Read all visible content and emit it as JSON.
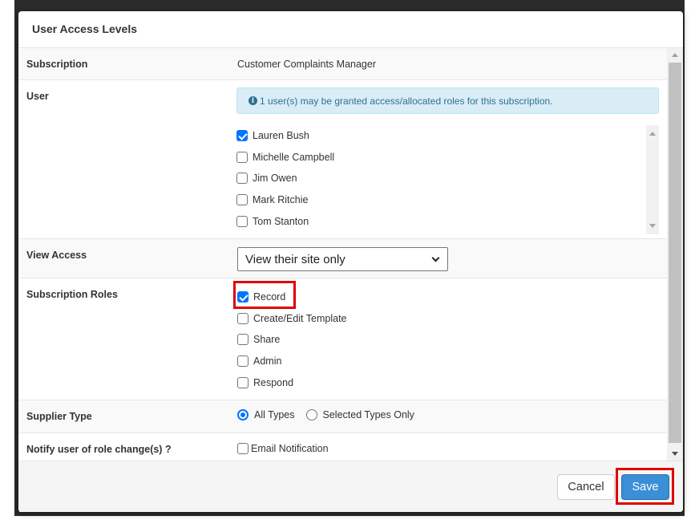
{
  "modal": {
    "title": "User Access Levels"
  },
  "subscription": {
    "label": "Subscription",
    "value": "Customer Complaints Manager"
  },
  "user": {
    "label": "User",
    "info_message": "1 user(s) may be granted access/allocated roles for this subscription.",
    "users": [
      {
        "name": "Lauren Bush",
        "checked": true
      },
      {
        "name": "Michelle Campbell",
        "checked": false
      },
      {
        "name": "Jim Owen",
        "checked": false
      },
      {
        "name": "Mark Ritchie",
        "checked": false
      },
      {
        "name": "Tom Stanton",
        "checked": false
      }
    ]
  },
  "view_access": {
    "label": "View Access",
    "selected": "View their site only"
  },
  "subscription_roles": {
    "label": "Subscription Roles",
    "roles": [
      {
        "name": "Record",
        "checked": true
      },
      {
        "name": "Create/Edit Template",
        "checked": false
      },
      {
        "name": "Share",
        "checked": false
      },
      {
        "name": "Admin",
        "checked": false
      },
      {
        "name": "Respond",
        "checked": false
      }
    ]
  },
  "supplier_type": {
    "label": "Supplier Type",
    "options": [
      {
        "name": "All Types",
        "checked": true
      },
      {
        "name": "Selected Types Only",
        "checked": false
      }
    ]
  },
  "notify": {
    "label": "Notify user of role change(s) ?",
    "email_label": "Email Notification",
    "checked": false
  },
  "footer": {
    "cancel_label": "Cancel",
    "save_label": "Save"
  },
  "colors": {
    "primary": "#3a8fd6",
    "info_bg": "#d9edf7",
    "info_text": "#31708f",
    "highlight": "#e00000",
    "checkbox_checked": "#0075ff"
  }
}
